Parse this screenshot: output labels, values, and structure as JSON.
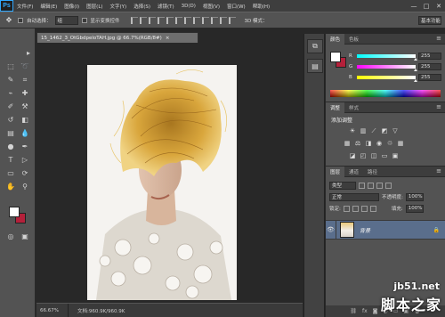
{
  "app": {
    "logo": "Ps",
    "menu": [
      "文件(F)",
      "编辑(E)",
      "图像(I)",
      "图层(L)",
      "文字(Y)",
      "选择(S)",
      "滤镜(T)",
      "3D(D)",
      "视图(V)",
      "窗口(W)",
      "帮助(H)"
    ],
    "window_buttons": [
      "—",
      "□",
      "✕"
    ]
  },
  "options": {
    "auto_select_label": "自动选择：",
    "auto_select_value": "组",
    "transform_label": "显示变换控件",
    "mode3d_label": "3D 模式：",
    "workspace": "基本功能"
  },
  "document": {
    "tab_title": "15_1462_3_OtGbdpeloTAH.jpg @ 66.7%(RGB/8#)",
    "close": "×",
    "zoom": "66.67%",
    "doc_size": "文档:960.9K/960.9K"
  },
  "panels": {
    "color": {
      "tabs": [
        "颜色",
        "色板"
      ],
      "sliders": [
        {
          "label": "R",
          "value": "255"
        },
        {
          "label": "G",
          "value": "255"
        },
        {
          "label": "B",
          "value": "255"
        }
      ],
      "fg": "#ffffff",
      "bg": "#b4203a"
    },
    "adjustments": {
      "tabs": [
        "调整",
        "样式"
      ],
      "title": "添加调整"
    },
    "layers": {
      "tabs": [
        "图层",
        "通道",
        "路径"
      ],
      "kind_filter": "类型",
      "blend_mode": "正常",
      "opacity_label": "不透明度:",
      "opacity_value": "100%",
      "lock_label": "锁定:",
      "fill_label": "填充:",
      "fill_value": "100%",
      "layer_name": "背景"
    }
  },
  "watermark": {
    "url": "jb51.net",
    "name": "脚本之家"
  },
  "colors": {
    "accent": "#31a8ff",
    "layer_selected": "#5a6e8c"
  }
}
